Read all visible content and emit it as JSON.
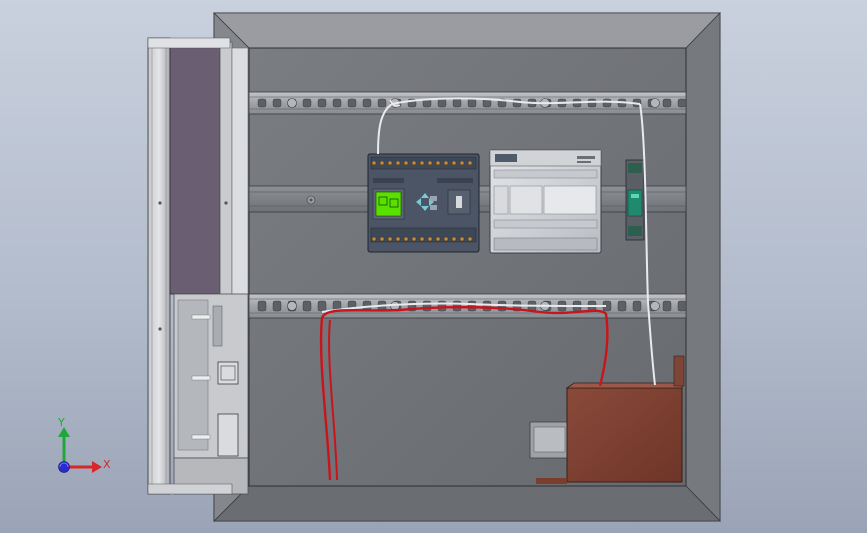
{
  "viewport": {
    "title": "",
    "background_top": "#c9d1de",
    "background_bottom": "#9aa4b6"
  },
  "triad": {
    "x_label": "X",
    "y_label": "Y",
    "x_color": "#d9262a",
    "y_color": "#1fa83a",
    "z_color": "#2a2ad0"
  },
  "enclosure": {
    "frame_color": "#7d7f84",
    "backplate_color": "#6f7277",
    "din_rail_color": "#a6a9ae",
    "door_panel_color": "#6a5f72"
  },
  "components": {
    "logo_module": "logic-module",
    "cpu_module": "plc-cpu",
    "power_supply": "din-power-supply",
    "terminal_block": "terminal-block"
  },
  "wires": {
    "red_color": "#c8151d",
    "white_color": "#e9eaee"
  }
}
